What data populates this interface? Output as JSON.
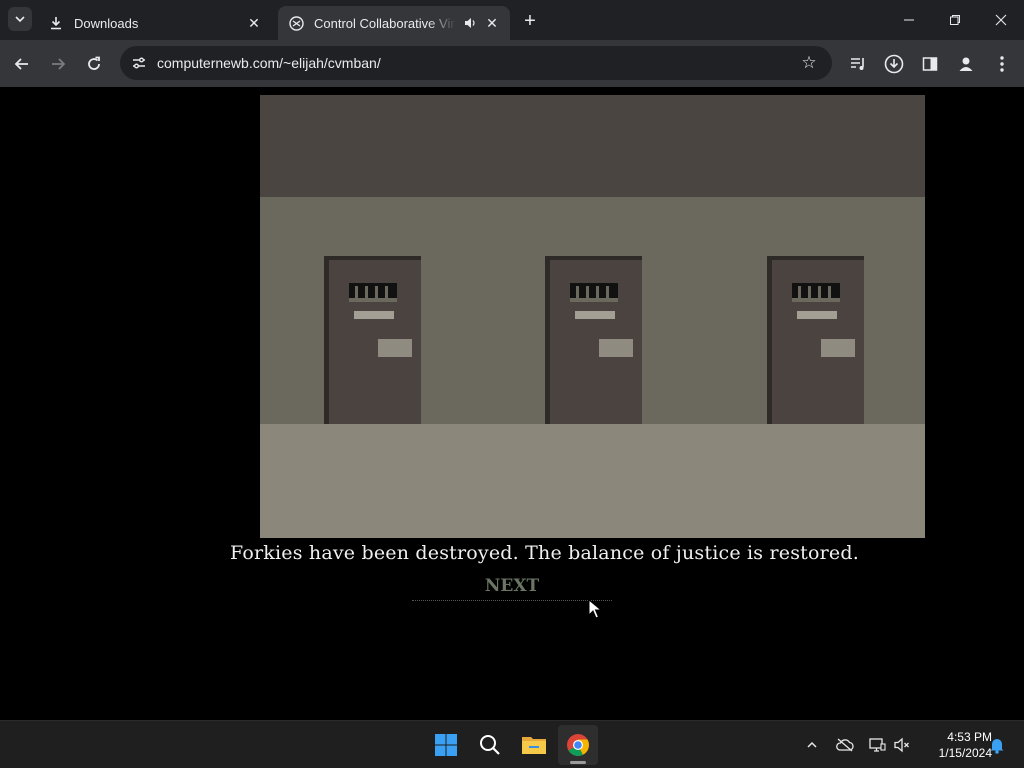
{
  "browser": {
    "tabs": [
      {
        "label": "Downloads",
        "icon": "download-icon",
        "active": false
      },
      {
        "label": "Control Collaborative Virtual Man",
        "icon": "site-favicon",
        "active": true,
        "audio": true
      }
    ],
    "address_bar": {
      "url": "computernewb.com/~elijah/cvmban/"
    }
  },
  "game": {
    "message": "Forkies have been destroyed. The balance of justice is restored.",
    "next_label": "NEXT",
    "doors": 3,
    "colors": {
      "ceiling": "#4b4541",
      "wall": "#6b685d",
      "floor": "#8b887b",
      "door": "#4a433f",
      "next": "#6b7564"
    }
  },
  "taskbar": {
    "apps": [
      "windows-start",
      "search",
      "file-explorer",
      "chrome"
    ],
    "time": "4:53 PM",
    "date": "1/15/2024"
  }
}
